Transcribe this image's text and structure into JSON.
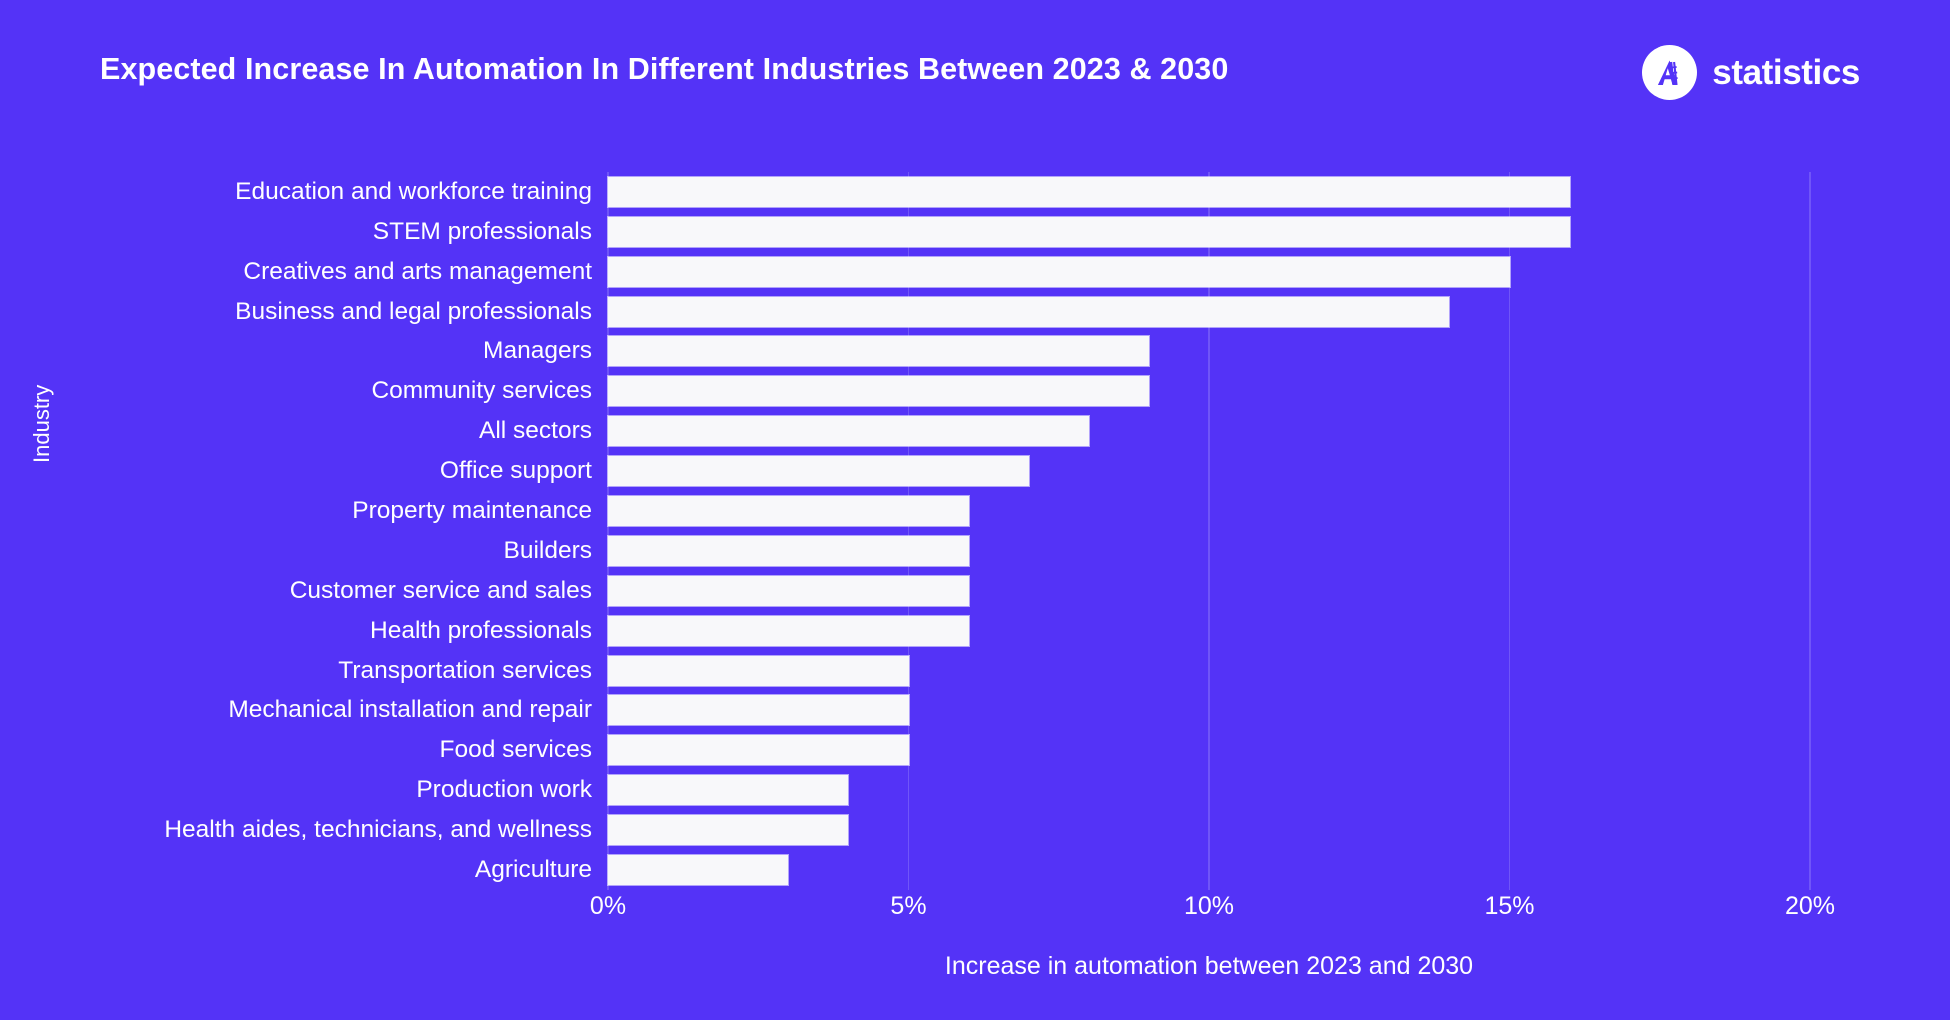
{
  "header": {
    "title": "Expected Increase In Automation In Different Industries Between 2023 & 2030",
    "brand_name": "statistics",
    "brand_mark_icon": "a-logo-icon"
  },
  "colors": {
    "background": "#5433F7",
    "bar": "#F8F8FA",
    "text": "#FFFFFF",
    "gridline": "rgba(255,255,255,0.17)"
  },
  "chart_data": {
    "type": "bar",
    "orientation": "horizontal",
    "title": "Expected Increase In Automation In Different Industries Between 2023 & 2030",
    "xlabel": "Increase in automation between 2023 and 2030",
    "ylabel": "Industry",
    "xlim": [
      0,
      20
    ],
    "xticks": [
      0,
      5,
      10,
      15,
      20
    ],
    "xticklabels": [
      "0%",
      "5%",
      "10%",
      "15%",
      "20%"
    ],
    "grid": true,
    "legend": false,
    "unit": "%",
    "categories": [
      "Education and workforce training",
      "STEM professionals",
      "Creatives and arts management",
      "Business and legal professionals",
      "Managers",
      "Community services",
      "All sectors",
      "Office support",
      "Property maintenance",
      "Builders",
      "Customer service and sales",
      "Health professionals",
      "Transportation services",
      "Mechanical installation and repair",
      "Food services",
      "Production work",
      "Health aides, technicians, and wellness",
      "Agriculture"
    ],
    "values": [
      16,
      16,
      15,
      14,
      9,
      9,
      8,
      7,
      6,
      6,
      6,
      6,
      5,
      5,
      5,
      4,
      4,
      3
    ]
  }
}
